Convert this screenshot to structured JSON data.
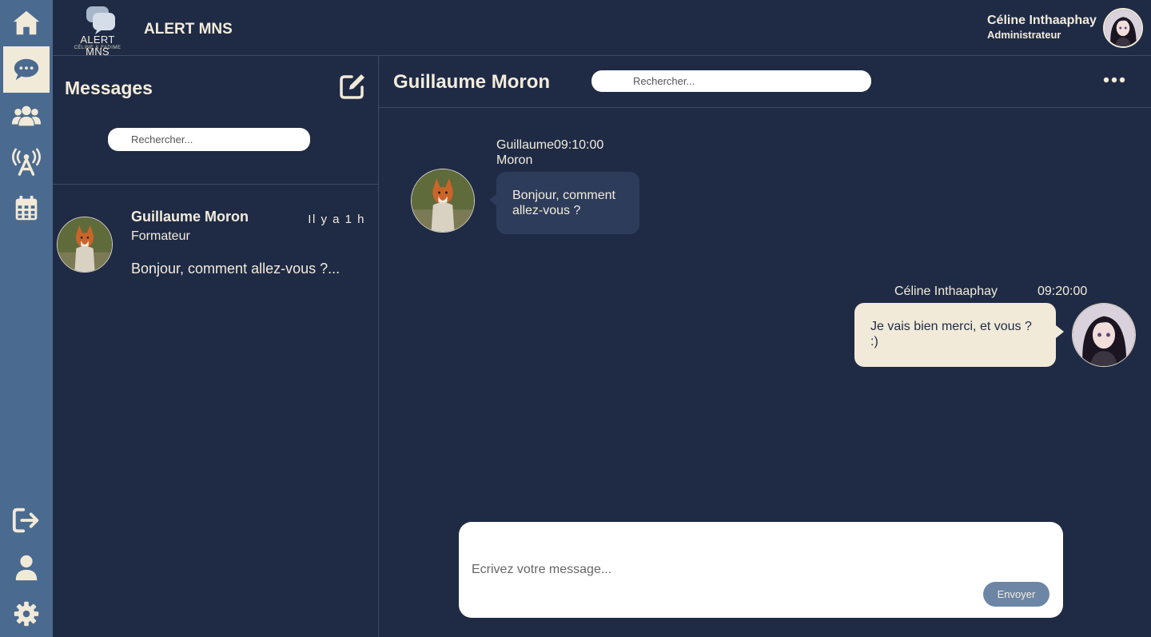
{
  "app": {
    "logo_text": "ALERT MNS",
    "logo_subtext": "CÉLINE & FADIME",
    "title": "ALERT MNS"
  },
  "user": {
    "name": "Céline Inthaaphay",
    "role": "Administrateur"
  },
  "rail": {
    "top_items": [
      {
        "icon": "home-icon",
        "active": false
      },
      {
        "icon": "chat-icon",
        "active": true
      },
      {
        "icon": "users-icon",
        "active": false
      },
      {
        "icon": "broadcast-icon",
        "active": false
      },
      {
        "icon": "calendar-icon",
        "active": false
      }
    ],
    "bottom_items": [
      {
        "icon": "logout-icon"
      },
      {
        "icon": "profile-icon"
      },
      {
        "icon": "gear-icon"
      }
    ]
  },
  "messages_panel": {
    "title": "Messages",
    "search_placeholder": "Rechercher...",
    "conversations": [
      {
        "name": "Guillaume Moron",
        "time": "Il y a 1 h",
        "role": "Formateur",
        "preview": "Bonjour, comment allez-vous ?..."
      }
    ]
  },
  "chat": {
    "title": "Guillaume Moron",
    "search_placeholder": "Rechercher...",
    "messages": [
      {
        "direction": "in",
        "sender_first": "Guillaume",
        "sender_last": "Moron",
        "time": "09:10:00",
        "text": "Bonjour, comment allez-vous ?"
      },
      {
        "direction": "out",
        "sender": "Céline Inthaaphay",
        "time": "09:20:00",
        "text": "Je vais bien merci, et vous ? :)"
      }
    ],
    "composer_placeholder": "Ecrivez votre message...",
    "send_label": "Envoyer"
  },
  "colors": {
    "background": "#1f2b45",
    "rail": "#4b6a8f",
    "cream": "#f1ead9",
    "send_button": "#6d86a6",
    "incoming_bubble": "#2d3c5a"
  }
}
